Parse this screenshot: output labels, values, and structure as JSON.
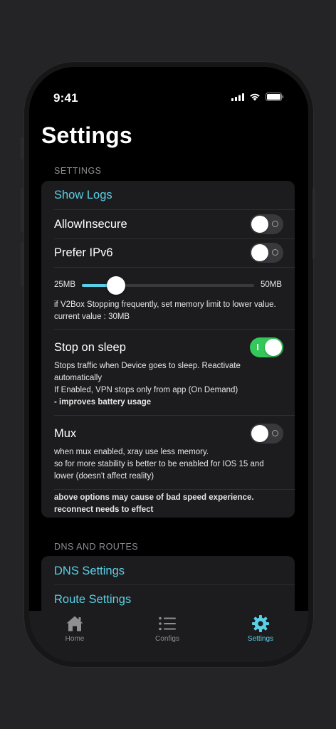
{
  "status_bar": {
    "time": "9:41"
  },
  "page": {
    "title": "Settings"
  },
  "settings_section": {
    "header": "SETTINGS",
    "show_logs_label": "Show Logs",
    "allow_insecure": {
      "label": "AllowInsecure",
      "enabled": false
    },
    "prefer_ipv6": {
      "label": "Prefer IPv6",
      "enabled": false
    },
    "memory_limit": {
      "min_label": "25MB",
      "max_label": "50MB",
      "value": 30,
      "min": 25,
      "max": 50,
      "description": "if V2Box Stopping frequently, set memory limit to lower value.",
      "current_value_text": "current value : 30MB"
    },
    "stop_on_sleep": {
      "label": "Stop on sleep",
      "enabled": true,
      "desc_line1": "Stops traffic when Device goes to sleep. Reactivate",
      "desc_line2": "automatically",
      "desc_line3": "If Enabled, VPN stops only from app (On Demand)",
      "desc_bold": "- improves battery usage"
    },
    "mux": {
      "label": "Mux",
      "enabled": false,
      "desc_line1": "when mux enabled, xray use less memory.",
      "desc_line2": "so for more stability is better to be enabled for IOS 15 and",
      "desc_line3": "lower (doesn't affect reality)"
    },
    "warning_line1": "above options may cause of bad speed experience.",
    "warning_line2": "reconnect needs to effect"
  },
  "dns_section": {
    "header": "DNS AND ROUTES",
    "dns_settings_label": "DNS Settings",
    "route_settings_label": "Route Settings"
  },
  "tabbar": {
    "home": {
      "label": "Home",
      "icon": "house-icon"
    },
    "configs": {
      "label": "Configs",
      "icon": "list-icon"
    },
    "settings": {
      "label": "Settings",
      "icon": "gear-icon",
      "active": true
    }
  },
  "colors": {
    "accent": "#5ad0e6",
    "toggle_on": "#34c759",
    "background": "#000000",
    "card": "#1c1c1e"
  }
}
